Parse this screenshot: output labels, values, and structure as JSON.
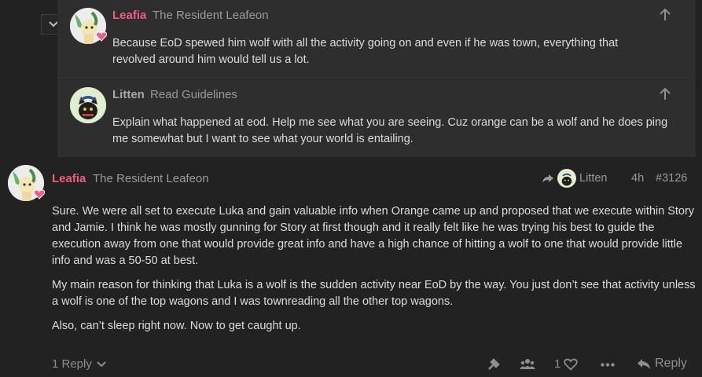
{
  "quote1": {
    "username": "Leafia",
    "title": "The Resident Leafeon",
    "text": "Because EoD spewed him wolf with all the activity going on and even if he was town, everything that revolved around him would tell us a lot."
  },
  "quote2": {
    "username": "Litten",
    "title": "Read Guidelines",
    "text": "Explain what happened at eod. Help me see what you are seeing. Cuz orange can be a wolf and he does ping me somewhat but I want to see what your world is entailing."
  },
  "post": {
    "username": "Leafia",
    "title": "The Resident Leafeon",
    "reply_to": "Litten",
    "age": "4h",
    "post_number": "#3126",
    "paragraphs": [
      "Sure. We were all set to execute Luka and gain valuable info when Orange came up and proposed that we execute within Story and Jamie. I think he was mostly gunning for Story at first though and it really felt like he was trying his best to guide the execution away from one that would provide great info and have a high chance of hitting a wolf to one that would provide little info and was a 50-50 at best.",
      "My main reason for thinking that Luka is a wolf is the sudden activity near EoD by the way. You just don’t see that activity unless a wolf is one of the top wagons and I was townreading all the other top wagons.",
      "Also, can’t sleep right now. Now to get caught up."
    ]
  },
  "actions": {
    "replies_label": "1 Reply",
    "like_count": "1",
    "reply_label": "Reply"
  },
  "colors": {
    "background": "#222222",
    "quote_background": "#2e2e2e",
    "username_pink": "#f45a85",
    "username_grey": "#a8a8a8"
  }
}
